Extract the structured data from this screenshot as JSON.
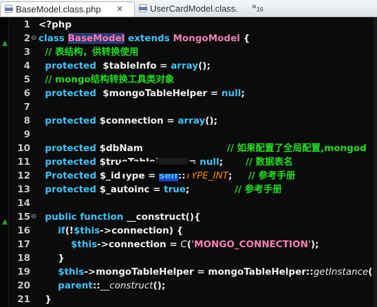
{
  "tabs": [
    {
      "label": "BaseModel.class.php",
      "close": "✕",
      "active": true
    },
    {
      "label": "UserCardModel.class.",
      "active": false
    }
  ],
  "overflow": {
    "label": "»",
    "count": "16"
  },
  "lines": [
    {
      "n": "1",
      "fold": "",
      "segs": [
        [
          "fn",
          "<?php"
        ]
      ]
    },
    {
      "n": "2",
      "fold": "⊖",
      "segs": [
        [
          "kw",
          "class "
        ],
        [
          "cls-sel",
          "BaseModel"
        ],
        [
          "kw",
          " extends "
        ],
        [
          "cls",
          "MongoModel"
        ],
        [
          "fn",
          " {"
        ]
      ]
    },
    {
      "n": "3",
      "fold": "",
      "segs": [
        [
          "cm",
          "  // 表结构，供转换使用"
        ]
      ]
    },
    {
      "n": "4",
      "fold": "",
      "segs": [
        [
          "kw",
          "  protected  "
        ],
        [
          "var",
          "$tableInfo"
        ],
        [
          "fn",
          " = "
        ],
        [
          "kw",
          "array"
        ],
        [
          "fn",
          "();"
        ]
      ]
    },
    {
      "n": "5",
      "fold": "",
      "segs": [
        [
          "cm",
          "  // mongo结构转换工具类对象"
        ]
      ]
    },
    {
      "n": "6",
      "fold": "",
      "segs": [
        [
          "kw",
          "  protected  "
        ],
        [
          "var",
          "$mongoTableHelper"
        ],
        [
          "fn",
          " = "
        ],
        [
          "kw",
          "null"
        ],
        [
          "fn",
          ";"
        ]
      ]
    },
    {
      "n": "7",
      "fold": "",
      "segs": [
        [
          "fn",
          ""
        ]
      ]
    },
    {
      "n": "8",
      "fold": "",
      "segs": [
        [
          "kw",
          "  protected "
        ],
        [
          "var",
          "$connection"
        ],
        [
          "fn",
          " = "
        ],
        [
          "kw",
          "array"
        ],
        [
          "fn",
          "();"
        ]
      ]
    },
    {
      "n": "9",
      "fold": "",
      "segs": [
        [
          "fn",
          ""
        ]
      ]
    },
    {
      "n": "10",
      "fold": "",
      "segs": [
        [
          "kw",
          "  protected "
        ],
        [
          "var",
          "$dbNam"
        ],
        [
          "fn",
          "                          "
        ],
        [
          "cm",
          "// 如果配置了全局配置,mongod"
        ]
      ]
    },
    {
      "n": "11",
      "fold": "",
      "segs": [
        [
          "kw",
          "  protected "
        ],
        [
          "var",
          "$trueTableName"
        ],
        [
          "fn",
          " = "
        ],
        [
          "kw",
          "null"
        ],
        [
          "fn",
          ";       "
        ],
        [
          "cm",
          "// 数据表名"
        ]
      ]
    },
    {
      "n": "12",
      "fold": "",
      "segs": [
        [
          "kw",
          "  Protected "
        ],
        [
          "var",
          "$_idType"
        ],
        [
          "fn",
          " = "
        ],
        [
          "self",
          "self"
        ],
        [
          "fn",
          "::"
        ],
        [
          "const",
          "TYPE_INT"
        ],
        [
          "fn",
          ";     "
        ],
        [
          "cm",
          "// 参考手册"
        ]
      ]
    },
    {
      "n": "13",
      "fold": "",
      "segs": [
        [
          "kw",
          "  protected "
        ],
        [
          "var",
          "$_autoinc"
        ],
        [
          "fn",
          " = "
        ],
        [
          "kw",
          "true"
        ],
        [
          "fn",
          ";              "
        ],
        [
          "cm",
          "// 参考手册"
        ]
      ]
    },
    {
      "n": "14",
      "fold": "",
      "segs": [
        [
          "fn",
          ""
        ]
      ]
    },
    {
      "n": "15",
      "fold": "⊖",
      "segs": [
        [
          "kw",
          "  public function "
        ],
        [
          "fn",
          "__construct(){"
        ]
      ]
    },
    {
      "n": "16",
      "fold": "",
      "segs": [
        [
          "kw",
          "      if"
        ],
        [
          "fn",
          "(!"
        ],
        [
          "kw",
          "$this"
        ],
        [
          "fn",
          "->connection) {"
        ]
      ]
    },
    {
      "n": "17",
      "fold": "",
      "segs": [
        [
          "kw",
          "          $this"
        ],
        [
          "fn",
          "->connection = "
        ],
        [
          "it",
          "C"
        ],
        [
          "fn",
          "("
        ],
        [
          "str",
          "'MONGO_CONNECTION'"
        ],
        [
          "fn",
          ");"
        ]
      ]
    },
    {
      "n": "18",
      "fold": "",
      "segs": [
        [
          "fn",
          "      }"
        ]
      ]
    },
    {
      "n": "19",
      "fold": "",
      "segs": [
        [
          "kw",
          "      $this"
        ],
        [
          "fn",
          "->mongoTableHelper = mongoTableHelper::"
        ],
        [
          "it",
          "getInstance"
        ],
        [
          "fn",
          "();"
        ]
      ]
    },
    {
      "n": "20",
      "fold": "",
      "segs": [
        [
          "kw",
          "      parent"
        ],
        [
          "fn",
          "::"
        ],
        [
          "it",
          "__construct"
        ],
        [
          "fn",
          "();"
        ]
      ]
    },
    {
      "n": "21",
      "fold": "",
      "segs": [
        [
          "fn",
          "  }"
        ]
      ]
    }
  ]
}
